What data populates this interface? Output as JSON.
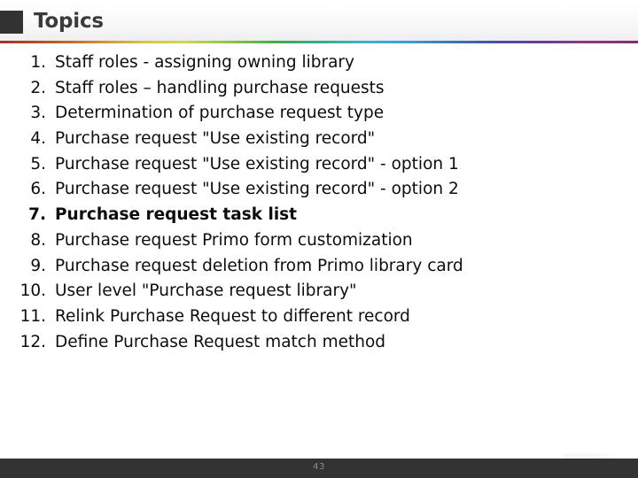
{
  "header": {
    "title": "Topics",
    "square_icon": "dark-square-bullet",
    "accent_colors": {
      "square": "#323232",
      "title_text": "#3b3b3b",
      "rule_start": "#a33226",
      "rule_mid": "#2fae84",
      "rule_end": "#7d2f6e"
    }
  },
  "topics": [
    {
      "num": "1.",
      "text": "Staff roles - assigning owning library",
      "bold": false
    },
    {
      "num": "2.",
      "text": "Staff roles – handling purchase requests",
      "bold": false
    },
    {
      "num": "3.",
      "text": "Determination of purchase request type",
      "bold": false
    },
    {
      "num": "4.",
      "text": "Purchase request \"Use existing record\"",
      "bold": false
    },
    {
      "num": "5.",
      "text": "Purchase request \"Use existing record\" - option 1",
      "bold": false
    },
    {
      "num": "6.",
      "text": "Purchase request \"Use existing record\" - option 2",
      "bold": false
    },
    {
      "num": "7.",
      "text": "Purchase request task list",
      "bold": true
    },
    {
      "num": "8.",
      "text": "Purchase request Primo form customization",
      "bold": false
    },
    {
      "num": "9.",
      "text": "Purchase request deletion from Primo library card",
      "bold": false
    },
    {
      "num": "10.",
      "text": "User level \"Purchase request library\"",
      "bold": false
    },
    {
      "num": "11.",
      "text": "Relink Purchase Request to different record",
      "bold": false
    },
    {
      "num": "12.",
      "text": "Define Purchase Request match method",
      "bold": false
    }
  ],
  "footer": {
    "page_number": "43",
    "background": "#333333",
    "text_color": "#8c8c8c"
  }
}
